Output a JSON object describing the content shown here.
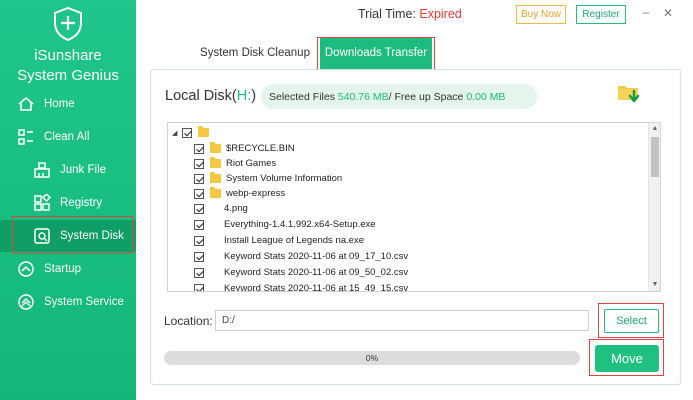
{
  "app": {
    "name_line1": "iSunshare",
    "name_line2": "System Genius"
  },
  "titlebar": {
    "trial_label": "Trial Time: ",
    "trial_status": "Expired",
    "buy_label": "Buy Now",
    "register_label": "Register",
    "minimize": "−",
    "close": "✕"
  },
  "sidebar": {
    "items": [
      {
        "label": "Home",
        "icon": "home-icon"
      },
      {
        "label": "Clean All",
        "icon": "clean-all-icon"
      },
      {
        "label": "Junk File",
        "icon": "broom-icon"
      },
      {
        "label": "Registry",
        "icon": "registry-icon"
      },
      {
        "label": "System Disk",
        "icon": "disk-icon",
        "active": true
      },
      {
        "label": "Startup",
        "icon": "startup-icon"
      },
      {
        "label": "System Service",
        "icon": "service-icon"
      }
    ]
  },
  "tabs": [
    {
      "label": "System Disk Cleanup"
    },
    {
      "label": "Downloads Transfer",
      "active": true
    }
  ],
  "disk": {
    "label_prefix": "Local Disk(",
    "drive": "H:",
    "label_suffix": ")",
    "selected_label": "Selected Files ",
    "selected_value": "540.76 MB",
    "separator": " / Free up Space ",
    "free_value": "0.00 MB"
  },
  "tree": {
    "root_label": "",
    "folders": [
      "$RECYCLE.BIN",
      "Riot Games",
      "System Volume Information",
      "webp-express"
    ],
    "files": [
      "4.png",
      "Everything-1.4.1.992.x64-Setup.exe",
      "Install League of Legends na.exe",
      "Keyword Stats 2020-11-06 at 09_17_10.csv",
      "Keyword Stats 2020-11-06 at 09_50_02.csv",
      "Keyword Stats 2020-11-06 at 15_49_15.csv"
    ]
  },
  "location": {
    "label": "Location:",
    "value": "D:/"
  },
  "buttons": {
    "select": "Select",
    "move": "Move"
  },
  "progress": {
    "value": 0,
    "text": "0%"
  },
  "colors": {
    "accent": "#1dbb7e",
    "expired": "#e53935",
    "buy": "#e9a12b",
    "highlight_box": "#e0443e"
  }
}
